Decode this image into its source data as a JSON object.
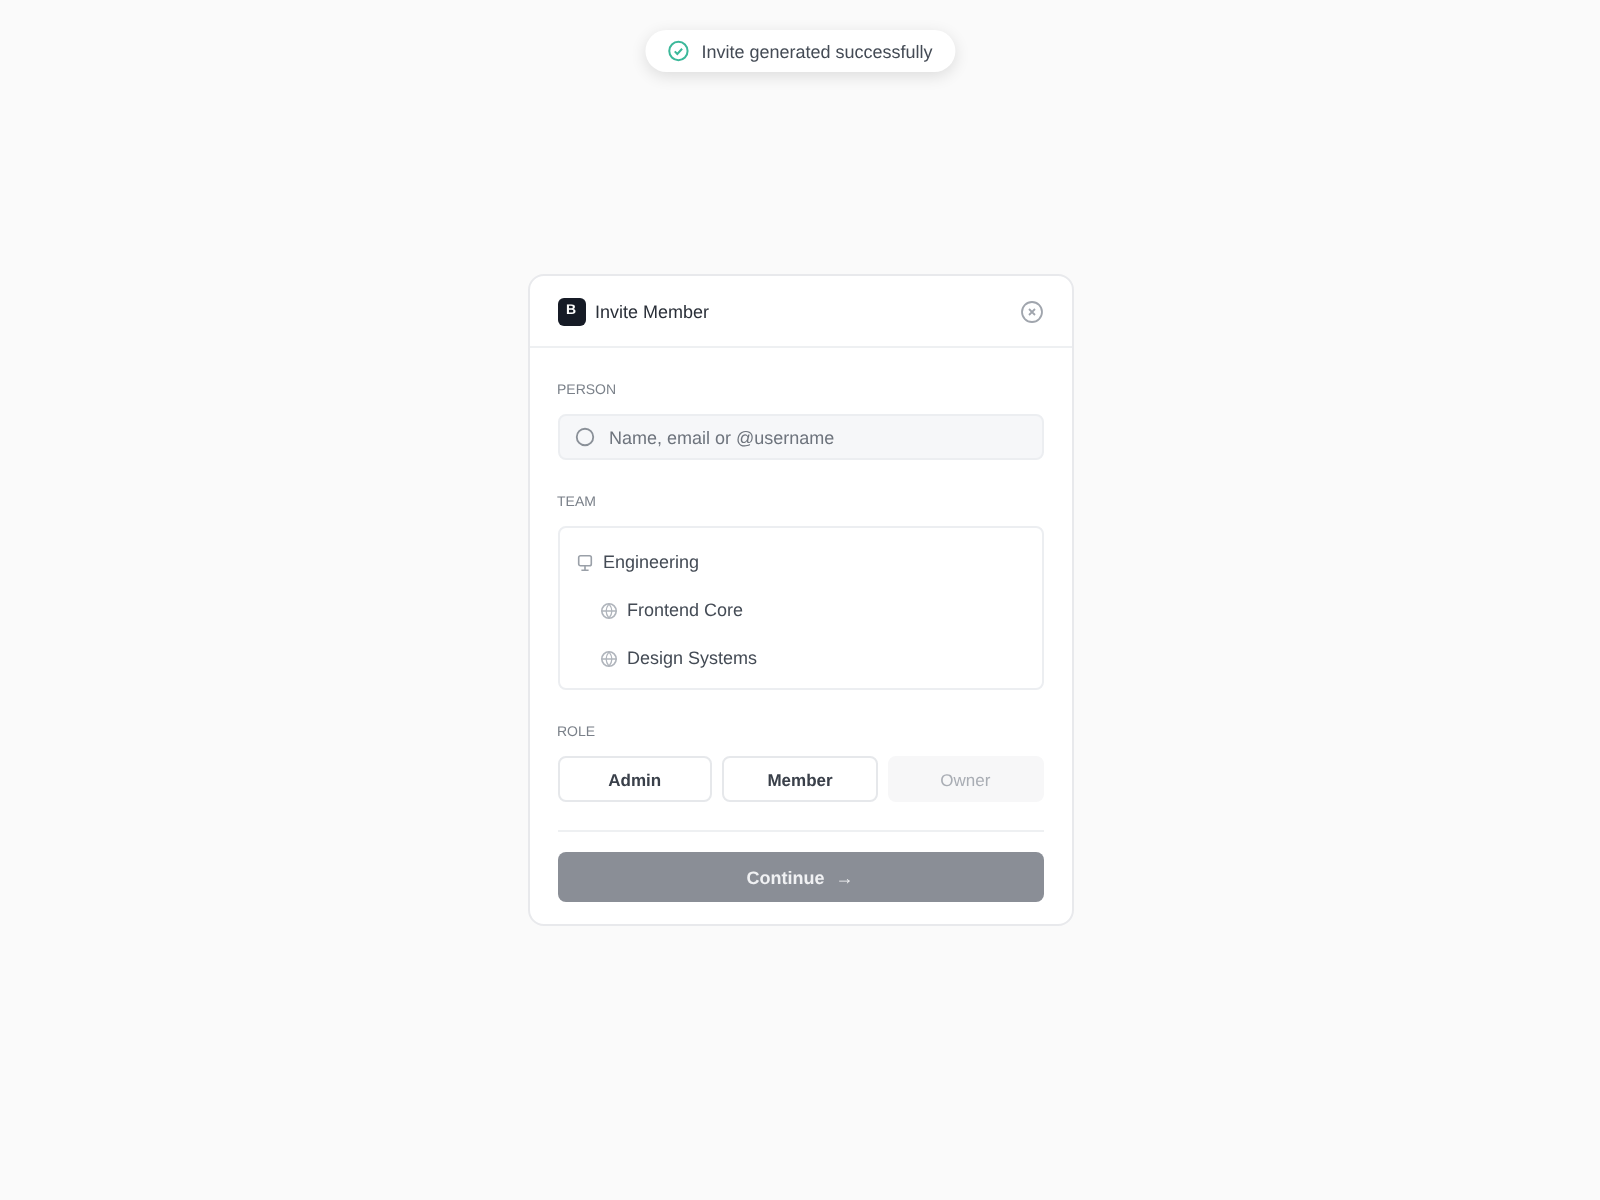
{
  "toast": {
    "message": "Invite generated successfully"
  },
  "dialog": {
    "logo": "B",
    "title": "Invite Member",
    "person": {
      "label": "PERSON",
      "placeholder": "Name, email or @username"
    },
    "team": {
      "label": "TEAM",
      "items": [
        {
          "name": "Engineering",
          "children": [
            {
              "name": "Frontend Core"
            },
            {
              "name": "Design Systems"
            }
          ]
        }
      ]
    },
    "role": {
      "label": "ROLE",
      "options": [
        {
          "label": "Admin",
          "disabled": false
        },
        {
          "label": "Member",
          "disabled": false
        },
        {
          "label": "Owner",
          "disabled": true
        }
      ]
    },
    "continue_button": {
      "label": "Continue",
      "arrow": "→",
      "disabled": true
    }
  }
}
